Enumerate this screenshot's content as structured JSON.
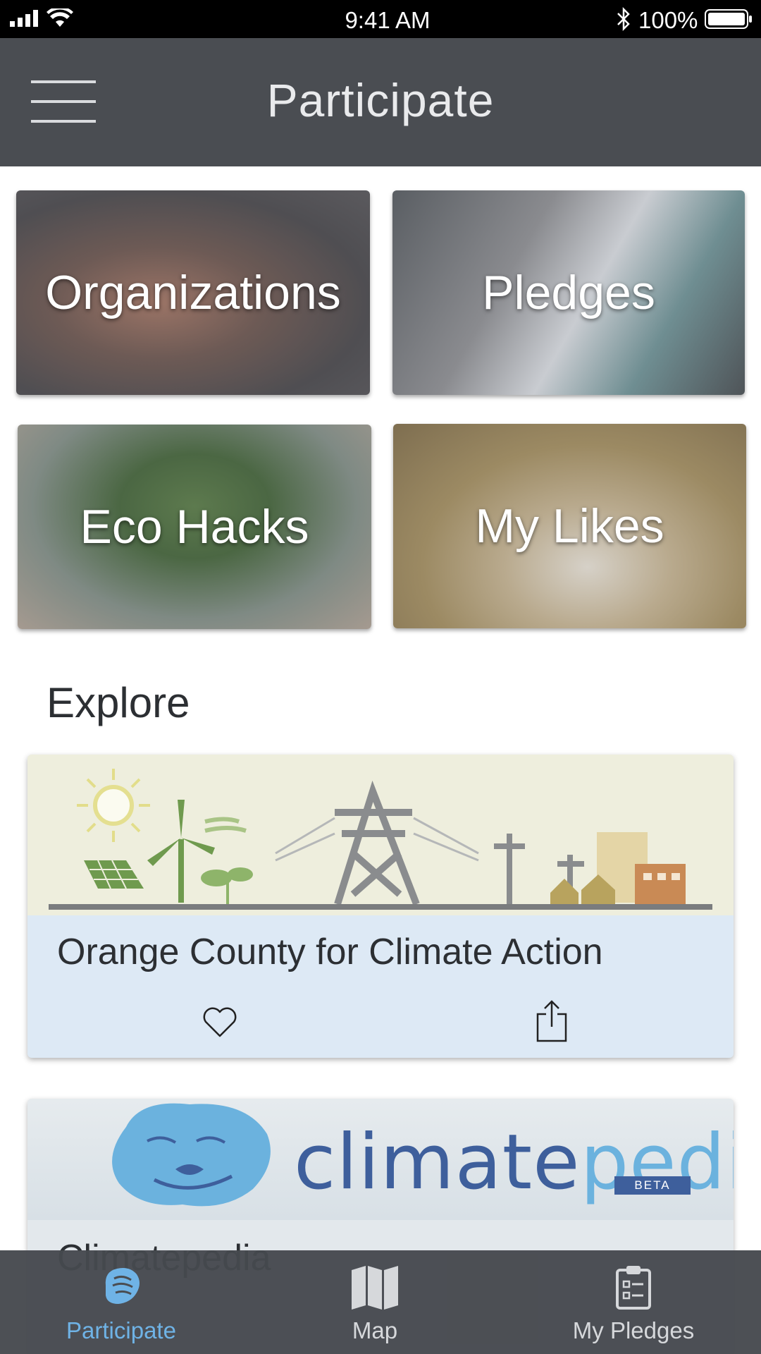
{
  "status_bar": {
    "time": "9:41 AM",
    "battery": "100%"
  },
  "header": {
    "title": "Participate",
    "menu_icon": "hamburger-menu-icon"
  },
  "tiles": [
    {
      "label": "Organizations"
    },
    {
      "label": "Pledges"
    },
    {
      "label": "Eco Hacks"
    },
    {
      "label": "My Likes"
    }
  ],
  "explore": {
    "title": "Explore",
    "cards": [
      {
        "title": "Orange County for Climate Action",
        "like_icon": "heart-icon",
        "share_icon": "share-icon"
      },
      {
        "title": "Climatepedia",
        "logo_text_a": "climate",
        "logo_text_b": "pedia",
        "logo_badge": "BETA"
      }
    ]
  },
  "tab_bar": {
    "tabs": [
      {
        "label": "Participate",
        "icon": "raised-fist-icon",
        "active": true
      },
      {
        "label": "Map",
        "icon": "map-icon",
        "active": false
      },
      {
        "label": "My Pledges",
        "icon": "clipboard-icon",
        "active": false
      }
    ]
  },
  "colors": {
    "header_bg": "#4a4d52",
    "accent": "#6fb3e6",
    "card_bg": "#dde9f5"
  }
}
